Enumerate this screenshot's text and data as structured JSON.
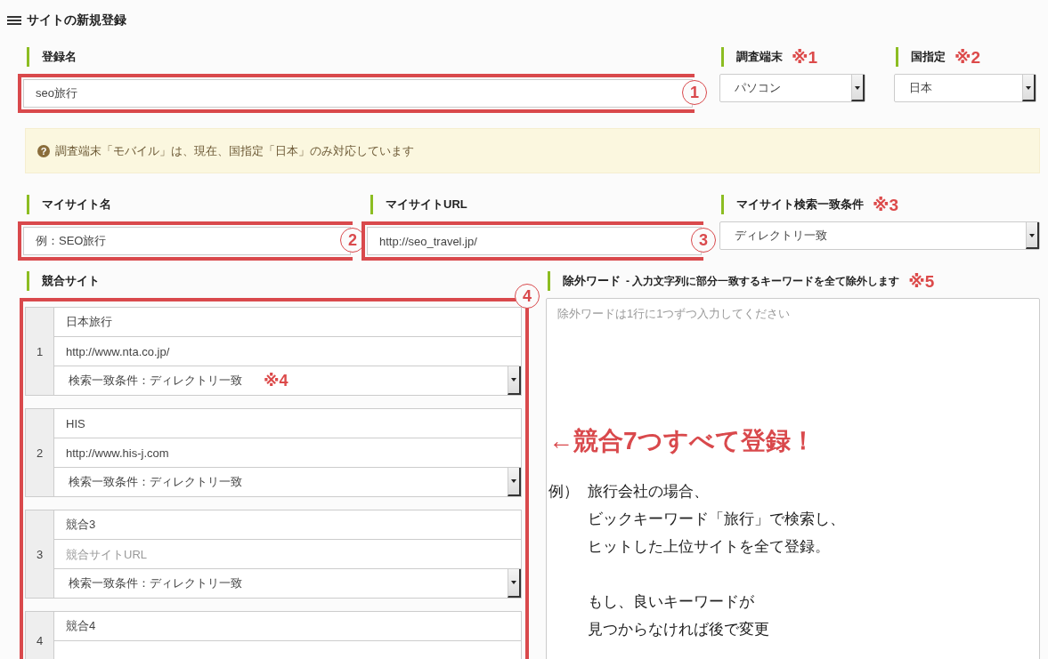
{
  "page_title": "サイトの新規登録",
  "registration_name": {
    "label": "登録名",
    "value": "seo旅行",
    "annotation": "1"
  },
  "device": {
    "label": "調査端末",
    "note": "※1",
    "value": "パソコン"
  },
  "country": {
    "label": "国指定",
    "note": "※2",
    "value": "日本"
  },
  "notice": {
    "icon": "?",
    "text": "調査端末「モバイル」は、現在、国指定「日本」のみ対応しています"
  },
  "my_site_name": {
    "label": "マイサイト名",
    "value": "例：SEO旅行",
    "annotation": "2"
  },
  "my_site_url": {
    "label": "マイサイトURL",
    "value": "http://seo_travel.jp/",
    "annotation": "3"
  },
  "my_site_match": {
    "label": "マイサイト検索一致条件",
    "note": "※3",
    "value": "ディレクトリ一致"
  },
  "competitors": {
    "label": "競合サイト",
    "annotation": "4",
    "items": [
      {
        "number": "1",
        "name": "日本旅行",
        "url": "http://www.nta.co.jp/",
        "condition": "検索一致条件：ディレクトリ一致",
        "note": "※4"
      },
      {
        "number": "2",
        "name": "HIS",
        "url": "http://www.his-j.com",
        "condition": "検索一致条件：ディレクトリ一致"
      },
      {
        "number": "3",
        "name": "競合3",
        "url_placeholder": "競合サイトURL",
        "condition": "検索一致条件：ディレクトリ一致"
      },
      {
        "number": "4",
        "name": "競合4"
      }
    ]
  },
  "exclude_words": {
    "label": "除外ワード",
    "description": "- 入力文字列に部分一致するキーワードを全て除外します",
    "note": "※5",
    "placeholder": "除外ワードは1行に1つずつ入力してください"
  },
  "callout": {
    "headline": "←競合7つすべて登録！",
    "prefix": "例）",
    "paragraphs": [
      [
        "旅行会社の場合、",
        "ビックキーワード「旅行」で検索し、",
        "ヒットした上位サイトを全て登録。"
      ],
      [
        "もし、良いキーワードが",
        "見つからなければ後で変更"
      ]
    ]
  }
}
